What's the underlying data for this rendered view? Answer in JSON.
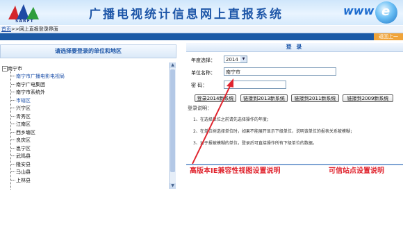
{
  "banner": {
    "logo_text": "SARFT",
    "title": "广播电视统计信息网上直报系统",
    "www": "www"
  },
  "breadcrumb": {
    "home": "首页",
    "separator": ">>",
    "current": "网上直报登录界面"
  },
  "topbar": {
    "back_label": "返回上一"
  },
  "left": {
    "heading": "请选择要登录的单位和地区",
    "root": "南宁市",
    "items": [
      "南宁市广播电影电视局",
      "南宁广电集团",
      "南宁市系统外",
      "市辖区",
      "兴宁区",
      "青秀区",
      "江南区",
      "西乡塘区",
      "良庆区",
      "邕宁区",
      "武鸣县",
      "隆安县",
      "马山县",
      "上林县"
    ],
    "highlighted": [
      "南宁市广播电影电视局",
      "市辖区"
    ]
  },
  "login": {
    "heading": "登 录",
    "year_label": "年度选择：",
    "year_value": "2014",
    "unit_label": "单位名称：",
    "unit_value": "南宁市",
    "password_label": "密      码：",
    "password_value": "",
    "buttons": {
      "login_2014": "登录2014新系统",
      "switch_2013": "链接到2013新系统",
      "switch_2011": "链接到2011新系统",
      "switch_2009": "链接到2009新系统"
    },
    "notes_title": "登录说明：",
    "notes": [
      "1、在选择单位之前请先选择操作的年度；",
      "2、在单位树选择单位时，如果不能展开显示下级单位，说明该单位的报表关系被模糊；",
      "3、对于报被模糊的单位，登录后可直接操作所有下级单位的数据。"
    ]
  },
  "footer_links": {
    "ie_compat": "高版本IE兼容性视图设置说明",
    "trusted_site": "可信站点设置说明"
  },
  "colors": {
    "accent": "#1d56a8",
    "link_red": "#e0242e",
    "arrow": "#e0242e"
  }
}
